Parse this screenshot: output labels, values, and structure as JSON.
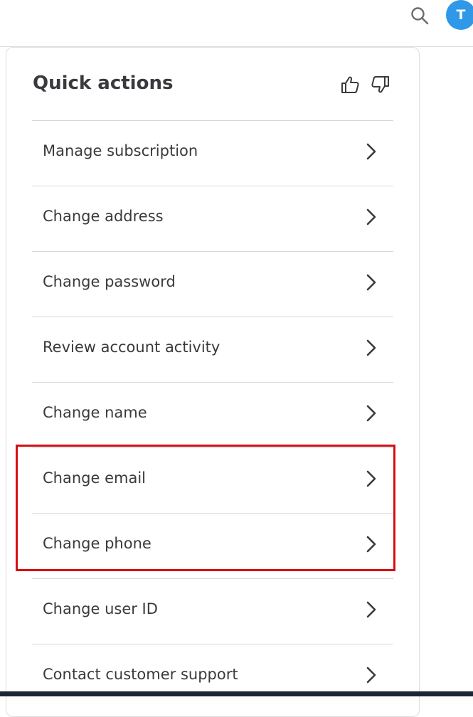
{
  "header": {
    "search_icon": "search-icon",
    "avatar_initial": "T",
    "avatar_color": "#2f98e8"
  },
  "quick_actions": {
    "title": "Quick actions",
    "feedback_icons": [
      "thumbs-up-icon",
      "thumbs-down-icon"
    ],
    "items": [
      {
        "label": "Manage subscription"
      },
      {
        "label": "Change address"
      },
      {
        "label": "Change password"
      },
      {
        "label": "Review account activity"
      },
      {
        "label": "Change name"
      },
      {
        "label": "Change email"
      },
      {
        "label": "Change phone"
      },
      {
        "label": "Change user ID"
      },
      {
        "label": "Contact customer support"
      }
    ],
    "highlight_color": "#d50f14"
  }
}
